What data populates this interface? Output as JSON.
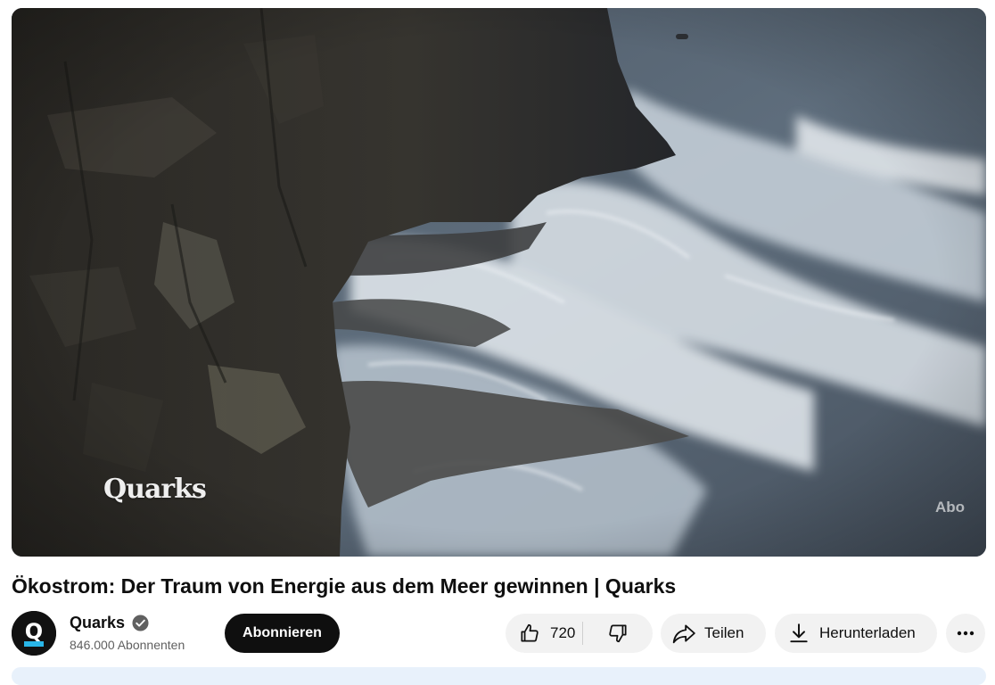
{
  "video": {
    "watermark": "Quarks",
    "overlay_badge": "Abo",
    "title": "Ökostrom: Der Traum von Energie aus dem Meer gewinnen | Quarks"
  },
  "channel": {
    "avatar_letter": "Q",
    "name": "Quarks",
    "verified_icon": "check-circle-icon",
    "subscribers": "846.000 Abonnenten",
    "subscribe_label": "Abonnieren"
  },
  "actions": {
    "like_count": "720",
    "like_icon": "thumb-up-icon",
    "dislike_icon": "thumb-down-icon",
    "share_label": "Teilen",
    "share_icon": "share-arrow-icon",
    "download_label": "Herunterladen",
    "download_icon": "download-icon",
    "more_icon": "more-horizontal-icon"
  },
  "colors": {
    "subscribe_bg": "#0f0f0f",
    "pill_bg": "#f2f2f2",
    "avatar_accent": "#29b6e8",
    "description_bg": "#e8f1fb"
  }
}
